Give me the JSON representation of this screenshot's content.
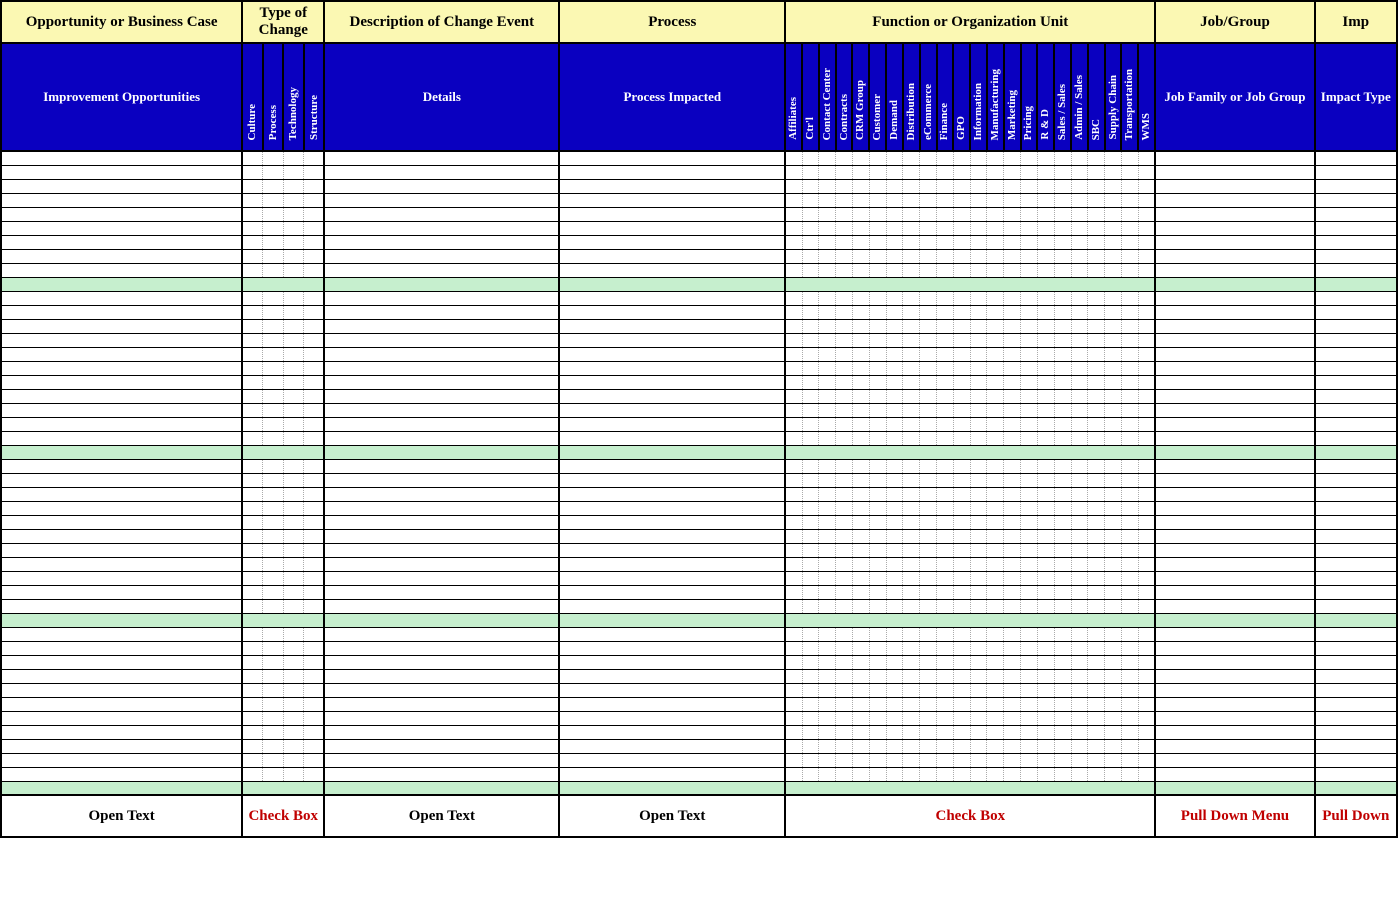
{
  "headers": {
    "top": {
      "c1": "Opportunity or Business Case",
      "c2": "Type of Change",
      "c3": "Description of Change Event",
      "c4": "Process",
      "c5": "Function or Organization Unit",
      "c6": "Job/Group",
      "c7": "Imp"
    },
    "sub": {
      "c1": "Improvement Opportunities",
      "type_cols": [
        "Culture",
        "Process",
        "Technology",
        "Structure"
      ],
      "c3": "Details",
      "c4": "Process Impacted",
      "func_cols": [
        "Affiliates",
        "Ctr'l",
        "Contact Center",
        "Contracts",
        "CRM Group",
        "Customer",
        "Demand",
        "Distribution",
        "eCommerce",
        "Finance",
        "GPO",
        "Information",
        "Manufacturing",
        "Marketing",
        "Pricing",
        "R & D",
        "Sales / Sales",
        "Admin / Sales",
        "SBC",
        "Supply Chain",
        "Transportation",
        "WMS"
      ],
      "c6": "Job Family or Job Group",
      "c7": "Impact Type"
    }
  },
  "footer": {
    "c1": "Open Text",
    "c2": "Check Box",
    "c3": "Open Text",
    "c4": "Open Text",
    "c5": "Check Box",
    "c6": "Pull Down Menu",
    "c7": "Pull Down"
  },
  "sections": [
    {
      "rows": 9
    },
    {
      "rows": 11
    },
    {
      "rows": 11
    },
    {
      "rows": 11
    }
  ]
}
